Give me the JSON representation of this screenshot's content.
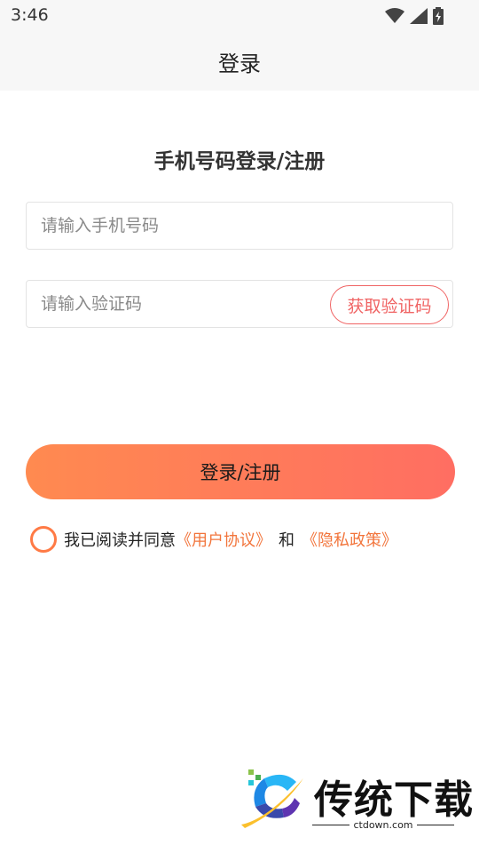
{
  "status_bar": {
    "time": "3:46",
    "icons": [
      "wifi-icon",
      "signal-icon",
      "battery-icon"
    ]
  },
  "header": {
    "title": "登录"
  },
  "form": {
    "title": "手机号码登录/注册",
    "phone_placeholder": "请输入手机号码",
    "code_placeholder": "请输入验证码",
    "get_code_label": "获取验证码",
    "submit_label": "登录/注册"
  },
  "agreement": {
    "prefix": "我已阅读并同意",
    "user_agreement": "《用户协议》",
    "and": "和",
    "privacy_policy": "《隐私政策》",
    "checked": false
  },
  "watermark": {
    "brand": "传统下载",
    "domain": "ctdown.com"
  },
  "colors": {
    "accent": "#f06464",
    "link": "#f2753c",
    "button_gradient_start": "#ff8a50",
    "button_gradient_end": "#ff6e62",
    "checkbox": "#ff7a45"
  }
}
